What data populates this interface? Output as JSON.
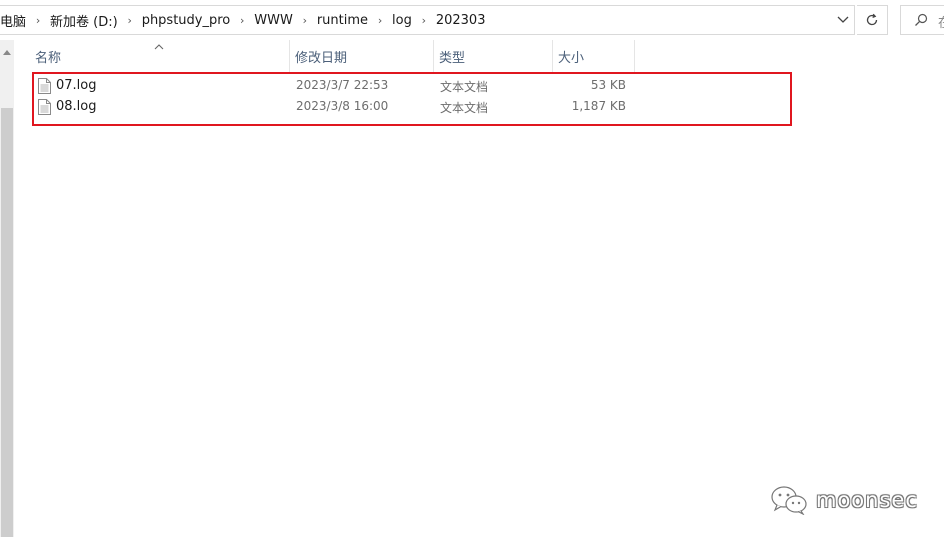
{
  "address_bar": {
    "crumbs": [
      "电脑",
      "新加卷 (D:)",
      "phpstudy_pro",
      "WWW",
      "runtime",
      "log",
      "202303"
    ],
    "dropdown_icon": "chevron-down-icon",
    "refresh_icon": "refresh-icon"
  },
  "search": {
    "icon": "search-icon",
    "hint": "在"
  },
  "columns": {
    "name": "名称",
    "date": "修改日期",
    "type": "类型",
    "size": "大小"
  },
  "files": [
    {
      "name": "07.log",
      "date": "2023/3/7 22:53",
      "type": "文本文档",
      "size": "53 KB"
    },
    {
      "name": "08.log",
      "date": "2023/3/8 16:00",
      "type": "文本文档",
      "size": "1,187 KB"
    }
  ],
  "highlight_color": "#e0161f",
  "watermark": {
    "text": "moonsec",
    "icon": "wechat-logo-icon"
  }
}
